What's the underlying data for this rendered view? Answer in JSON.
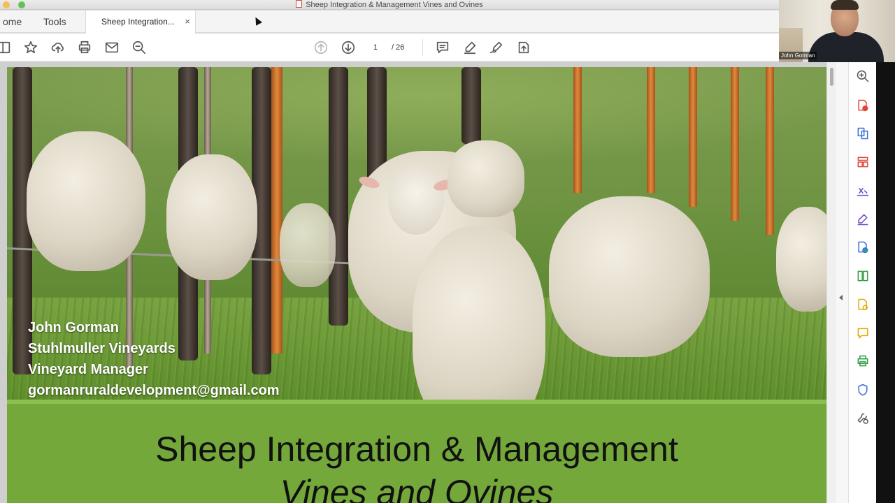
{
  "window": {
    "title": "Sheep Integration & Management Vines and Ovines"
  },
  "tabs": {
    "home_label": "ome",
    "tools_label": "Tools",
    "doc_label": "Sheep Integration...",
    "close_glyph": "×"
  },
  "toolbar": {
    "icons": [
      "sidebar-icon",
      "bookmark-star-icon",
      "upload-icon",
      "print-icon",
      "email-icon",
      "zoom-out-icon",
      "previous-page-icon",
      "next-page-icon",
      "comment-icon",
      "highlight-pen-icon",
      "sign-icon",
      "share-icon"
    ],
    "page_current": "1",
    "page_total": "/ 26"
  },
  "slide": {
    "caption": {
      "name": "John Gorman",
      "company": "Stuhlmuller Vineyards",
      "role": "Vineyard Manager",
      "email": "gormanruraldevelopment@gmail.com"
    },
    "title": "Sheep Integration & Management",
    "subtitle": "Vines and Ovines",
    "band_color": "#74a83a"
  },
  "right_tools": {
    "icons": [
      "zoom-icon",
      "create-pdf-icon",
      "export-pdf-icon",
      "organize-pages-icon",
      "edit-text-icon",
      "fill-sign-icon",
      "combine-files-icon",
      "compress-pdf-icon",
      "scan-icon",
      "comment-tool-icon",
      "print-production-icon",
      "protect-icon",
      "more-tools-icon"
    ]
  },
  "video": {
    "participant_name": "John Gorman"
  }
}
